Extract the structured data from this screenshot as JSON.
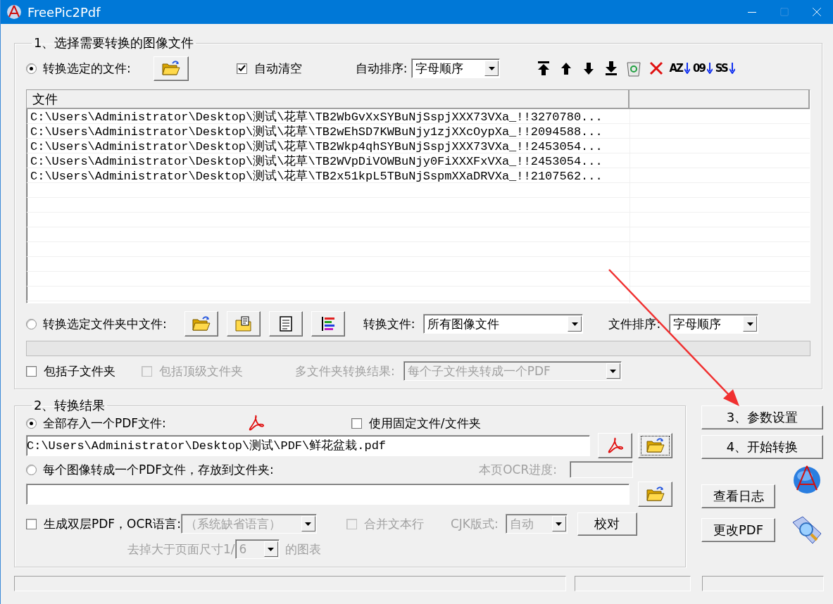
{
  "window": {
    "title": "FreePic2Pdf"
  },
  "section_1": {
    "legend": "1、选择需要转换的图像文件",
    "convert_selected_files": {
      "label": "转换选定的文件:",
      "selected": true
    },
    "auto_clear": {
      "label": "自动清空",
      "checked": true,
      "disabled": false
    },
    "auto_sort": {
      "label": "自动排序:",
      "value": "字母顺序",
      "disabled": false
    },
    "sort_buttons": [
      {
        "label": "AZ"
      },
      {
        "label": "09"
      },
      {
        "label": "SS"
      }
    ],
    "file_list": {
      "columns": [
        "文件"
      ],
      "rows": [
        "C:\\Users\\Administrator\\Desktop\\测试\\花草\\TB2WbGvXxSYBuNjSspjXXX73VXa_!!3270780...",
        "C:\\Users\\Administrator\\Desktop\\测试\\花草\\TB2wEhSD7KWBuNjy1zjXXcOypXa_!!2094588...",
        "C:\\Users\\Administrator\\Desktop\\测试\\花草\\TB2Wkp4qhSYBuNjSspjXXX73VXa_!!2453054...",
        "C:\\Users\\Administrator\\Desktop\\测试\\花草\\TB2WVpDiVOWBuNjy0FiXXXFxVXa_!!2453054...",
        "C:\\Users\\Administrator\\Desktop\\测试\\花草\\TB2x51kpL5TBuNjSspmXXaDRVXa_!!2107562..."
      ]
    },
    "convert_folder_files": {
      "label": "转换选定文件夹中文件:",
      "selected": false
    },
    "convert_files": {
      "label": "转换文件:",
      "value": "所有图像文件",
      "disabled": false
    },
    "file_sort": {
      "label": "文件排序:",
      "value": "字母顺序",
      "disabled": false
    },
    "folder_progress": {
      "level": 0
    },
    "include_subfolders": {
      "label": "包括子文件夹",
      "checked": false,
      "disabled": false
    },
    "include_top_folder": {
      "label": "包括顶级文件夹",
      "checked": false,
      "disabled": true
    },
    "multi_folder_result": {
      "label": "多文件夹转换结果:",
      "value": "每个子文件夹转成一个PDF",
      "disabled": true
    }
  },
  "section_2": {
    "legend": "2、转换结果",
    "single_pdf": {
      "label": "全部存入一个PDF文件:",
      "selected": true
    },
    "fixed_file": {
      "label": "使用固定文件/文件夹",
      "checked": false,
      "disabled": false
    },
    "output_file": {
      "value": "C:\\Users\\Administrator\\Desktop\\测试\\PDF\\鲜花盆栽.pdf"
    },
    "per_image_pdf": {
      "label": "每个图像转成一个PDF文件，存放到文件夹:",
      "selected": false
    },
    "ocr_progress": {
      "label": "本页OCR进度:",
      "disabled": true
    },
    "dual_layer": {
      "label": "生成双层PDF，OCR语言:",
      "checked": false,
      "disabled": false
    },
    "ocr_language": {
      "value": "（系统缺省语言）",
      "disabled": true
    },
    "merge_lines": {
      "label": "合并文本行",
      "checked": false,
      "disabled": true
    },
    "cjk_layout": {
      "label": "CJK版式:",
      "value": "自动",
      "disabled": true
    },
    "proofread_button": "校对",
    "remove_graphics": {
      "prefix": "去掉大于页面尺寸1/",
      "value": "6",
      "suffix": "的图表",
      "disabled": true
    }
  },
  "side_buttons": [
    "3、参数设置",
    "4、开始转换"
  ],
  "log_button": "查看日志",
  "modify_pdf_button": "更改PDF"
}
